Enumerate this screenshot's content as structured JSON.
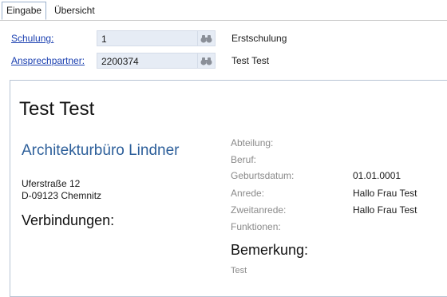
{
  "tabs": [
    {
      "label": "Eingabe",
      "active": true
    },
    {
      "label": "Übersicht",
      "active": false
    }
  ],
  "form": {
    "schulung": {
      "label": "Schulung:",
      "value": "1",
      "description": "Erstschulung"
    },
    "ansprechpartner": {
      "label": "Ansprechpartner:",
      "value": "2200374",
      "description": "Test Test"
    }
  },
  "card": {
    "name": "Test Test",
    "company": "Architekturbüro Lindner",
    "street": "Uferstraße 12",
    "city": "D-09123 Chemnitz",
    "connections_heading": "Verbindungen:",
    "fields": [
      {
        "label": "Abteilung:",
        "value": ""
      },
      {
        "label": "Beruf:",
        "value": ""
      },
      {
        "label": "Geburtsdatum:",
        "value": "01.01.0001"
      },
      {
        "label": "Anrede:",
        "value": "Hallo Frau Test"
      },
      {
        "label": "Zweitanrede:",
        "value": "Hallo Frau Test"
      },
      {
        "label": "Funktionen:",
        "value": ""
      }
    ],
    "remark_heading": "Bemerkung:",
    "remark_text": "Test"
  },
  "icons": {
    "lookup": "binoculars-icon"
  },
  "colors": {
    "link": "#1a3fb0",
    "company": "#2d5f9a",
    "input_bg": "#e6ecf5"
  }
}
